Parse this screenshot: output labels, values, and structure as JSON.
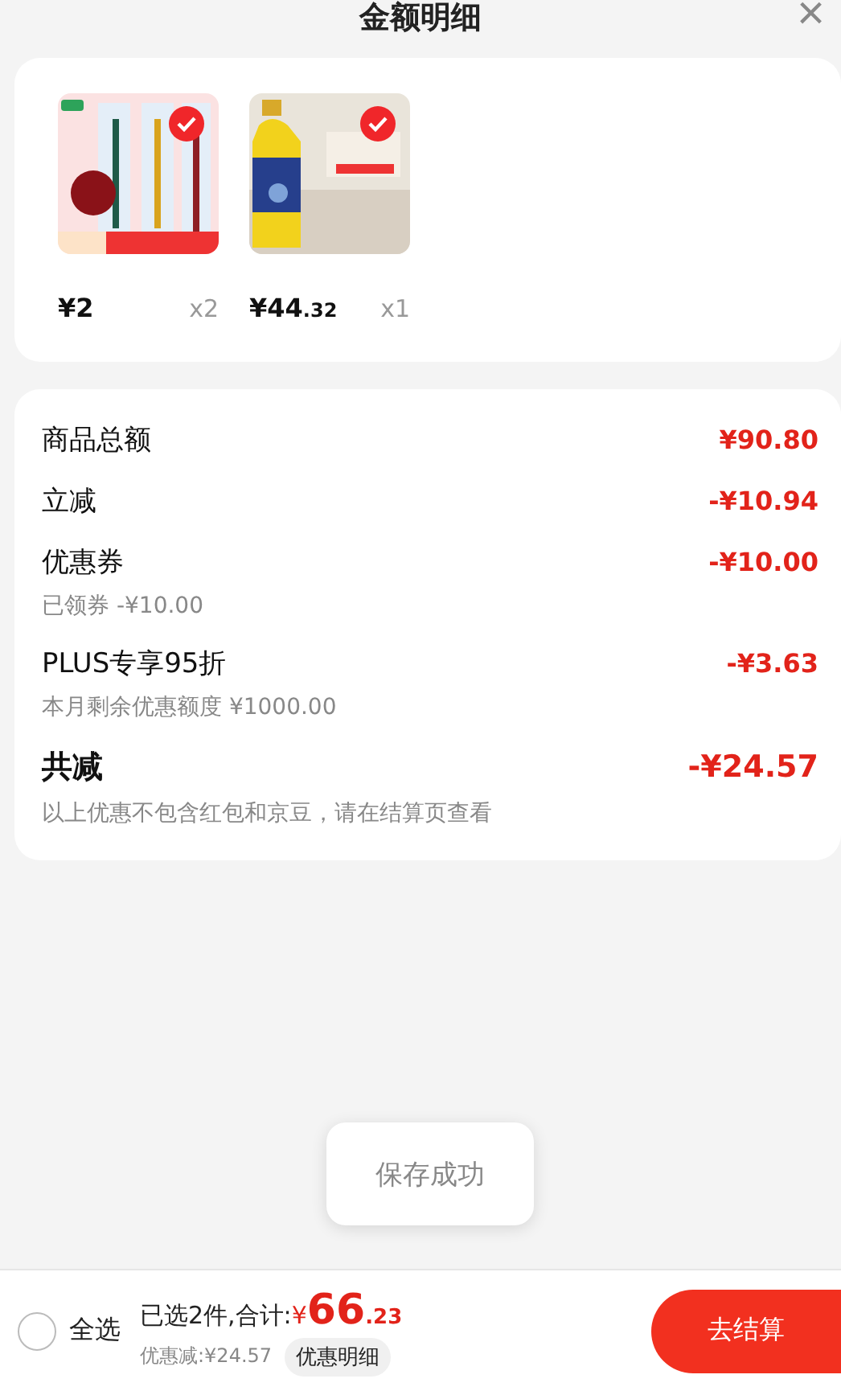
{
  "header": {
    "title": "金额明细",
    "close": "×"
  },
  "products": [
    {
      "selected": true,
      "price": "¥2",
      "quantity": "x2"
    },
    {
      "selected": true,
      "price": "¥44",
      "price_decimal": ".32",
      "quantity": "x1"
    }
  ],
  "summary": [
    {
      "kind": "line",
      "label": "商品总额",
      "amount": "¥90.80"
    },
    {
      "kind": "line",
      "label": "立减",
      "amount": "-¥10.94"
    },
    {
      "kind": "line",
      "label": "优惠券",
      "amount": "-¥10.00",
      "note": "已领券 -¥10.00"
    },
    {
      "kind": "line",
      "label": "PLUS专享95折",
      "amount": "-¥3.63",
      "note": "本月剩余优惠额度 ¥1000.00"
    },
    {
      "kind": "total",
      "label": "共减",
      "amount": "-¥24.57",
      "note": "以上优惠不包含红包和京豆，请在结算页查看"
    }
  ],
  "toast": "保存成功",
  "footer": {
    "select_all": {
      "label": "全选",
      "checked": false
    },
    "selected_count": "已选2件,合计:",
    "total_symbol": "¥",
    "total_main": "66",
    "total_decimal": ".23",
    "discount": "优惠减:¥24.57",
    "details_button": "优惠明细",
    "checkout_button": "去结算"
  }
}
